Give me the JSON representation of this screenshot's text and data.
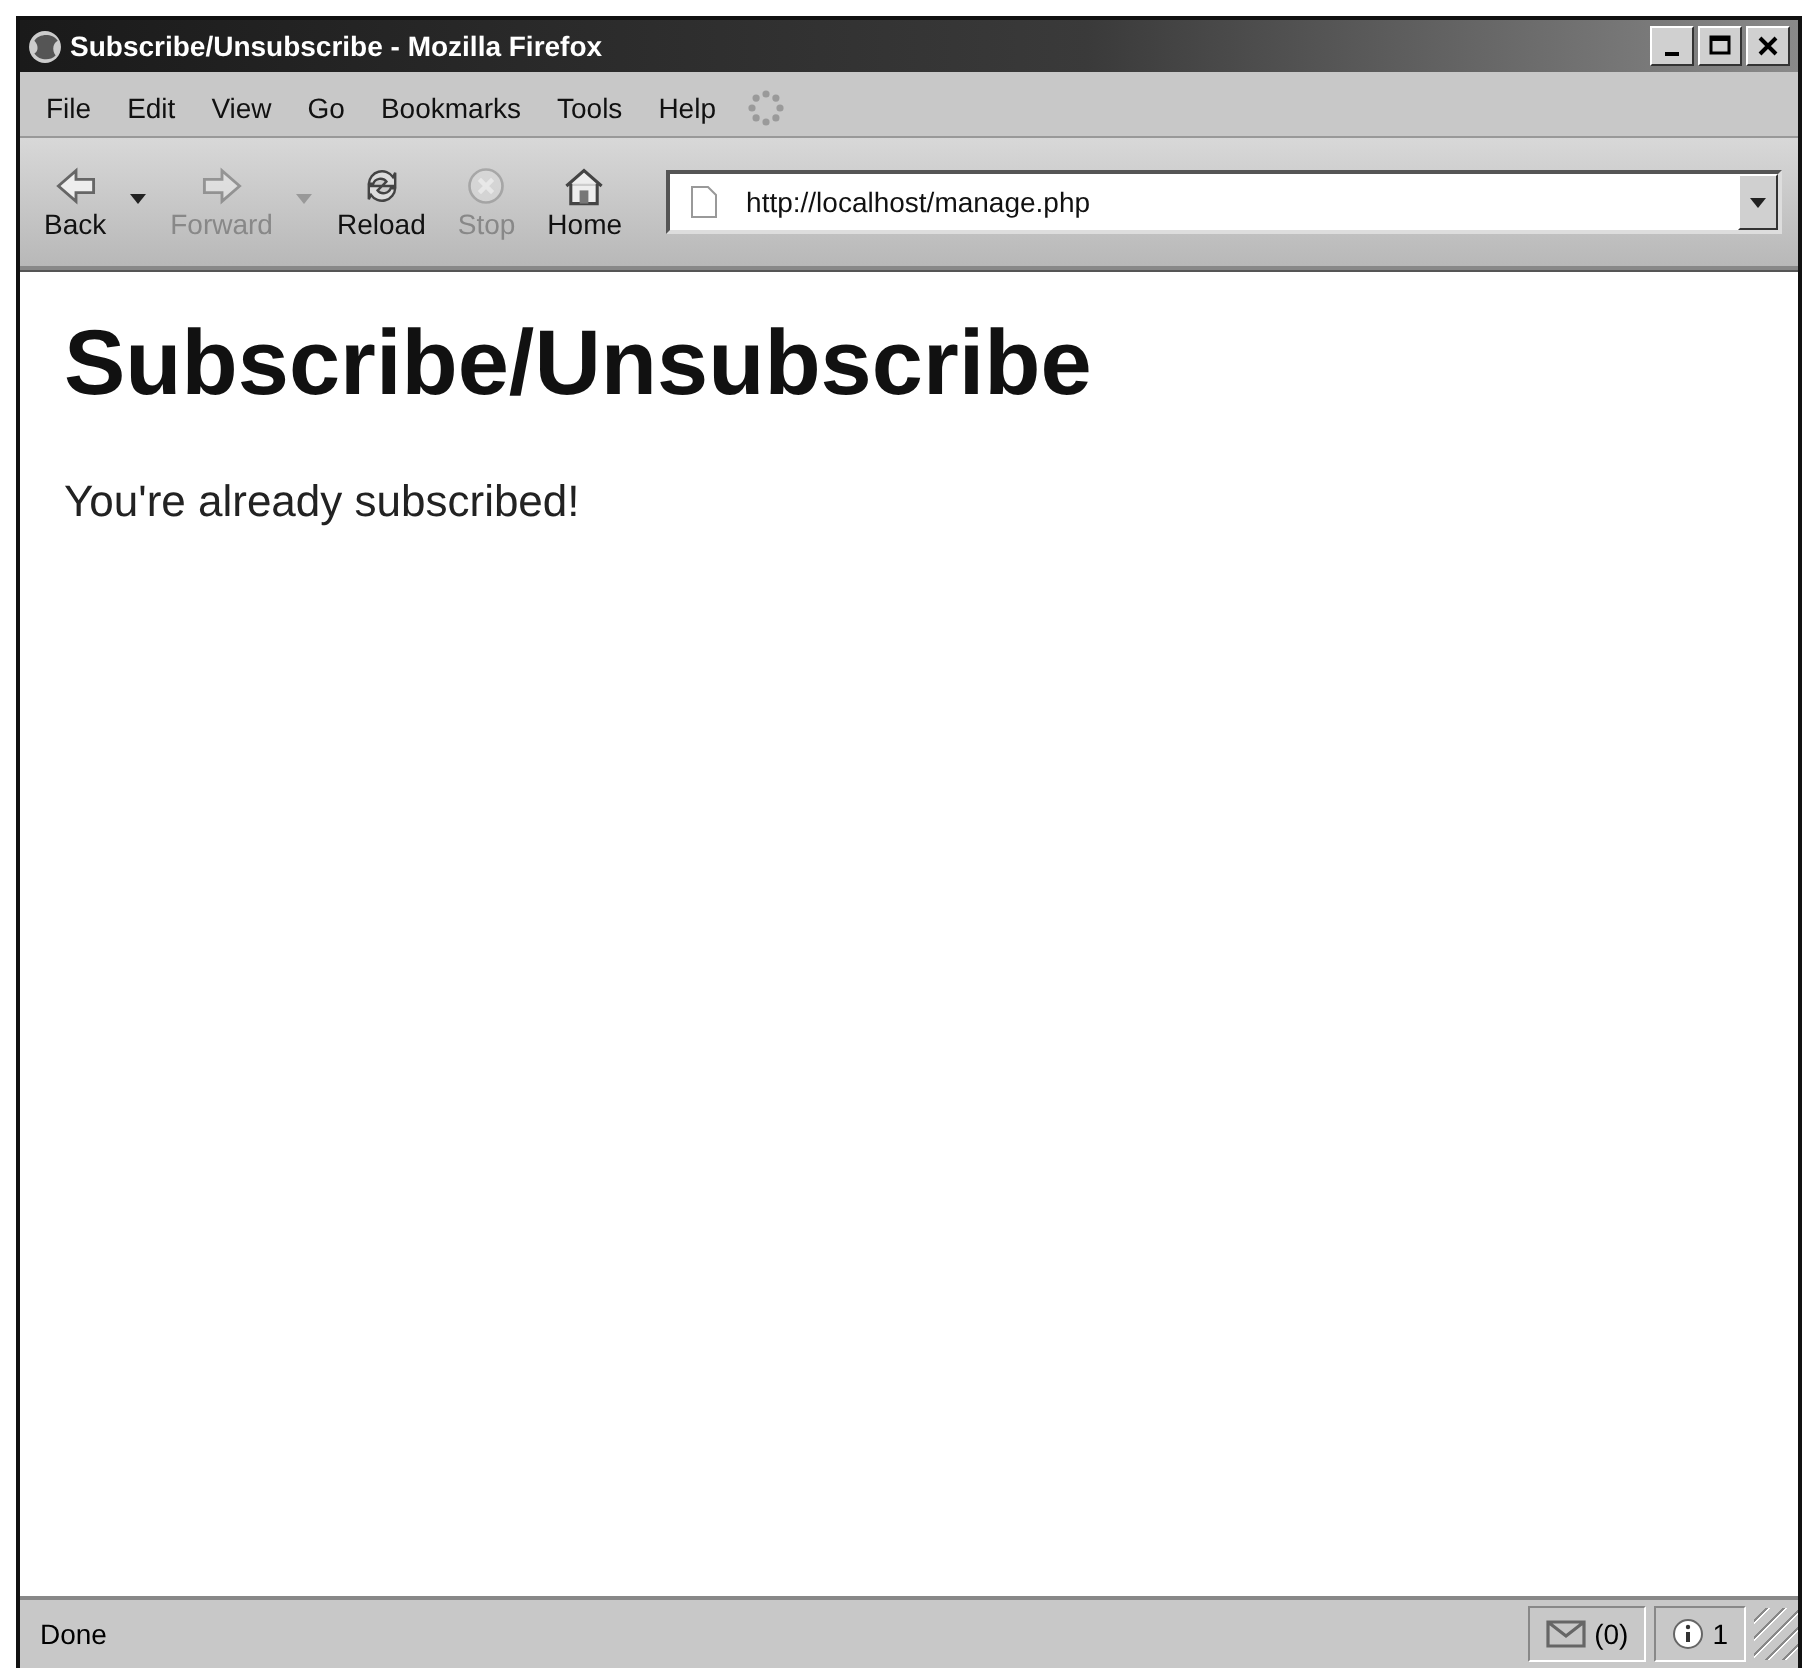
{
  "window": {
    "title": "Subscribe/Unsubscribe - Mozilla Firefox"
  },
  "menu": [
    "File",
    "Edit",
    "View",
    "Go",
    "Bookmarks",
    "Tools",
    "Help"
  ],
  "toolbar": [
    {
      "label": "Back",
      "disabled": false,
      "dropdown": true,
      "kind": "back"
    },
    {
      "label": "Forward",
      "disabled": true,
      "dropdown": true,
      "kind": "forward"
    },
    {
      "label": "Reload",
      "disabled": false,
      "dropdown": false,
      "kind": "reload"
    },
    {
      "label": "Stop",
      "disabled": true,
      "dropdown": false,
      "kind": "stop"
    },
    {
      "label": "Home",
      "disabled": false,
      "dropdown": false,
      "kind": "home"
    }
  ],
  "address": {
    "value": "http://localhost/manage.php"
  },
  "page": {
    "heading": "Subscribe/Unsubscribe",
    "paragraph": "You're already subscribed!"
  },
  "status_bar": {
    "text": "Done",
    "mail": "(0)",
    "info": "1"
  }
}
